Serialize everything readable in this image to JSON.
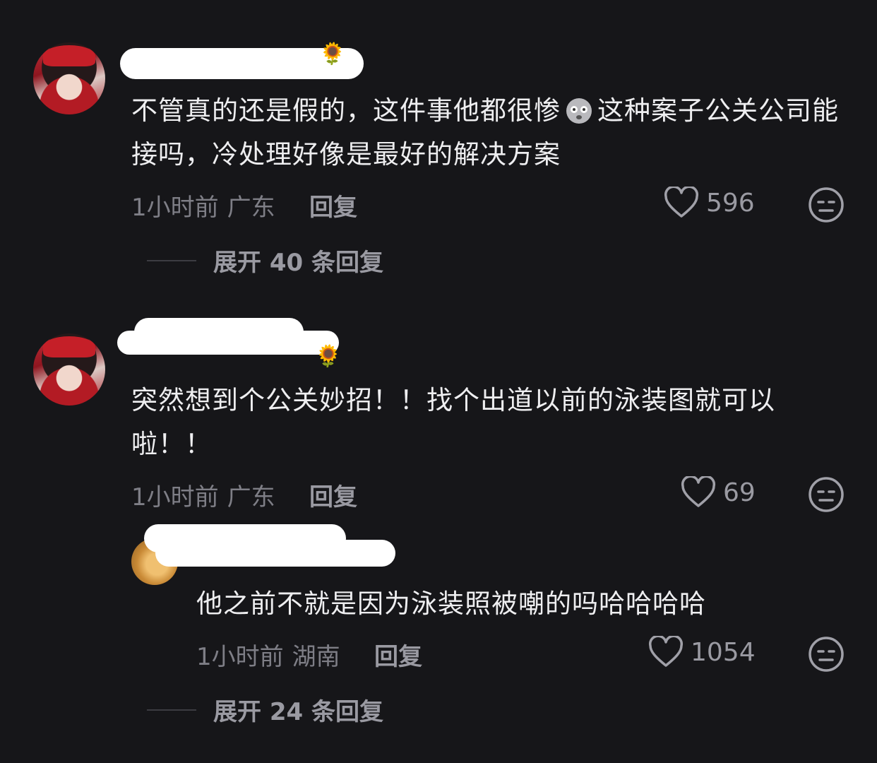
{
  "comments": [
    {
      "text_before_emoji": "不管真的还是假的，这件事他都很惨",
      "emoji": "sad-face-emoji",
      "text_after_emoji": "这种案子公关公司能接吗，冷处理好像是最好的解决方案",
      "time": "1小时前",
      "location": "广东",
      "reply_label": "回复",
      "likes": "596",
      "expand_label": "展开 40 条回复"
    },
    {
      "text": "突然想到个公关妙招！！找个出道以前的泳装图就可以啦！！",
      "time": "1小时前",
      "location": "广东",
      "reply_label": "回复",
      "likes": "69",
      "reply": {
        "text": "他之前不就是因为泳装照被嘲的吗哈哈哈哈",
        "time": "1小时前",
        "location": "湖南",
        "reply_label": "回复",
        "likes": "1054"
      },
      "expand_label": "展开 24 条回复"
    }
  ]
}
